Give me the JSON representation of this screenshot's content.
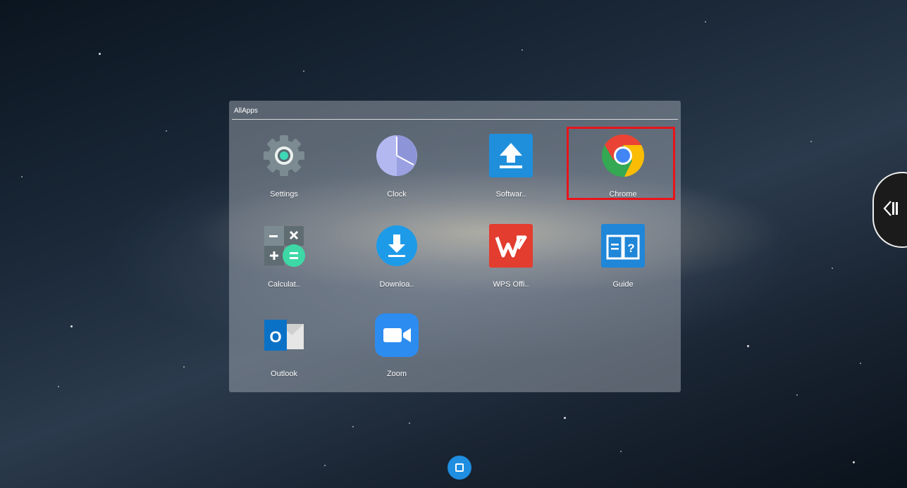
{
  "folder": {
    "title": "AllApps",
    "apps": [
      {
        "label": "Settings",
        "icon": "settings-gear-icon"
      },
      {
        "label": "Clock",
        "icon": "clock-icon"
      },
      {
        "label": "Softwar..",
        "icon": "software-upload-icon"
      },
      {
        "label": "Chrome",
        "icon": "chrome-icon"
      },
      {
        "label": "Calculat..",
        "icon": "calculator-icon"
      },
      {
        "label": "Downloa..",
        "icon": "download-icon"
      },
      {
        "label": "WPS Offi..",
        "icon": "wps-office-icon"
      },
      {
        "label": "Guide",
        "icon": "guide-book-icon"
      },
      {
        "label": "Outlook",
        "icon": "outlook-icon"
      },
      {
        "label": "Zoom",
        "icon": "zoom-camera-icon"
      }
    ]
  },
  "highlight_color": "#e8141c",
  "home_button_color": "#1f8ee0"
}
